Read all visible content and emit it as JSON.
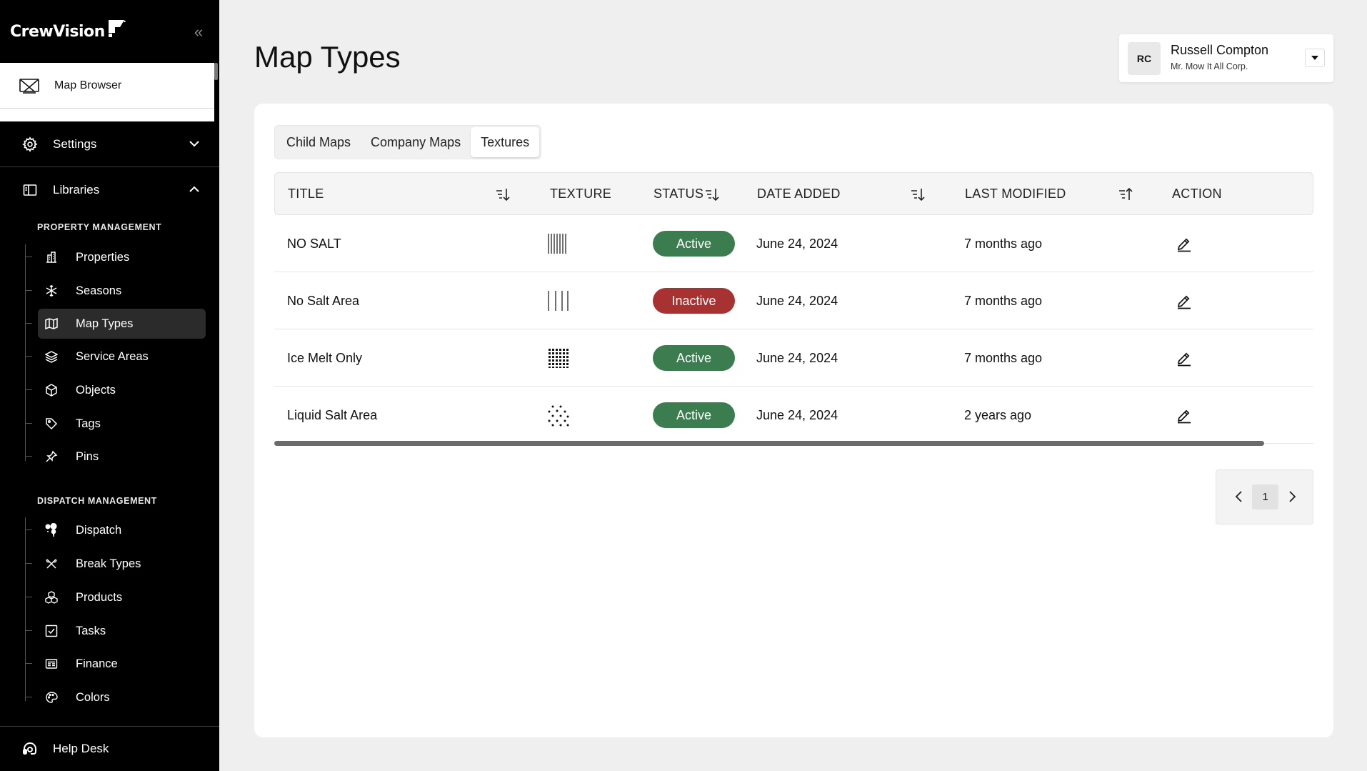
{
  "brand": {
    "name": "CrewVision"
  },
  "sidebar": {
    "map_browser": "Map Browser",
    "settings": "Settings",
    "libraries": "Libraries",
    "property_group": "PROPERTY MANAGEMENT",
    "property_items": [
      {
        "label": "Properties",
        "icon": "building-icon"
      },
      {
        "label": "Seasons",
        "icon": "snowflake-icon"
      },
      {
        "label": "Map Types",
        "icon": "map-icon",
        "active": true
      },
      {
        "label": "Service Areas",
        "icon": "layers-icon"
      },
      {
        "label": "Objects",
        "icon": "cube-icon"
      },
      {
        "label": "Tags",
        "icon": "tag-icon"
      },
      {
        "label": "Pins",
        "icon": "pin-icon"
      }
    ],
    "dispatch_group": "DISPATCH MANAGEMENT",
    "dispatch_items": [
      {
        "label": "Dispatch",
        "icon": "dispatch-icon"
      },
      {
        "label": "Break Types",
        "icon": "utensils-icon"
      },
      {
        "label": "Products",
        "icon": "boxes-icon"
      },
      {
        "label": "Tasks",
        "icon": "checkbox-icon"
      },
      {
        "label": "Finance",
        "icon": "finance-icon"
      },
      {
        "label": "Colors",
        "icon": "palette-icon"
      }
    ],
    "help_desk": "Help Desk"
  },
  "header": {
    "title": "Map Types",
    "user": {
      "initials": "RC",
      "name": "Russell Compton",
      "company": "Mr. Mow It All Corp."
    }
  },
  "tabs": [
    {
      "label": "Child Maps",
      "active": false
    },
    {
      "label": "Company Maps",
      "active": false
    },
    {
      "label": "Textures",
      "active": true
    }
  ],
  "table": {
    "columns": {
      "title": "TITLE",
      "texture": "TEXTURE",
      "status": "STATUS",
      "date_added": "DATE ADDED",
      "last_modified": "LAST MODIFIED",
      "action": "ACTION"
    },
    "rows": [
      {
        "title": "NO SALT",
        "texture": "dense-vertical-lines",
        "status": "Active",
        "date_added": "June 24, 2024",
        "last_modified": "7 months ago"
      },
      {
        "title": "No Salt Area",
        "texture": "sparse-vertical-lines",
        "status": "Inactive",
        "date_added": "June 24, 2024",
        "last_modified": "7 months ago"
      },
      {
        "title": "Ice Melt Only",
        "texture": "dot-grid",
        "status": "Active",
        "date_added": "June 24, 2024",
        "last_modified": "7 months ago"
      },
      {
        "title": "Liquid Salt Area",
        "texture": "scattered-dots",
        "status": "Active",
        "date_added": "June 24, 2024",
        "last_modified": "2 years ago"
      }
    ]
  },
  "pagination": {
    "current_page": "1"
  },
  "colors": {
    "active": "#3b7d4f",
    "inactive": "#a83232",
    "sidebar_bg": "#000000",
    "page_bg": "#efefef"
  }
}
